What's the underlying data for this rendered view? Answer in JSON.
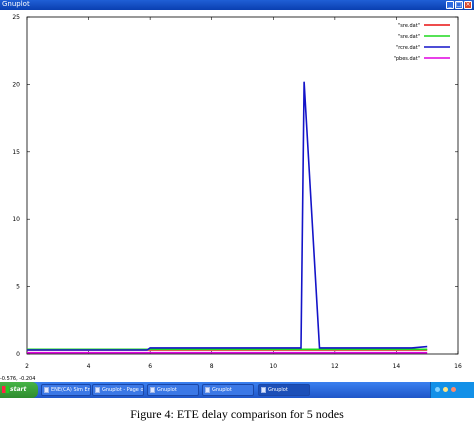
{
  "window": {
    "title": "Gnuplot"
  },
  "chart_data": {
    "type": "line",
    "xlim": [
      2,
      16
    ],
    "ylim": [
      0,
      25
    ],
    "x_ticks": [
      "2",
      "4",
      "6",
      "8",
      "10",
      "12",
      "14",
      "16"
    ],
    "y_ticks": [
      "0",
      "5",
      "10",
      "15",
      "20",
      "25"
    ],
    "legend_position": "top-right",
    "series": [
      {
        "name": "\"sre.dat\"",
        "color": "#e81010",
        "points": [
          [
            2,
            0.3
          ],
          [
            15,
            0.3
          ]
        ]
      },
      {
        "name": "\"sre.dat\"",
        "color": "#1ed81e",
        "points": [
          [
            2,
            0.35
          ],
          [
            15,
            0.35
          ]
        ]
      },
      {
        "name": "\"rcre.dat\"",
        "color": "#1414c8",
        "points": [
          [
            2,
            0.3
          ],
          [
            5.9,
            0.3
          ],
          [
            6.0,
            0.45
          ],
          [
            10.9,
            0.45
          ],
          [
            11.0,
            20.2
          ],
          [
            11.5,
            0.45
          ],
          [
            14.5,
            0.45
          ],
          [
            15,
            0.55
          ]
        ]
      },
      {
        "name": "\"pbes.dat\"",
        "color": "#e000e0",
        "points": [
          [
            2,
            0.1
          ],
          [
            15,
            0.1
          ]
        ]
      }
    ]
  },
  "status": {
    "coords": "-0.576, -0.204"
  },
  "taskbar": {
    "start_label": "start",
    "items": [
      {
        "label": "ENE(CA) Sim En...",
        "active": false
      },
      {
        "label": "Gnuplot - Page o...",
        "active": false
      },
      {
        "label": "Gnuplot",
        "active": false
      },
      {
        "label": "Gnuplot",
        "active": false
      },
      {
        "label": "Gnuplot",
        "active": true
      }
    ],
    "tray_time": ""
  },
  "caption": "Figure 4: ETE delay comparison for 5 nodes"
}
